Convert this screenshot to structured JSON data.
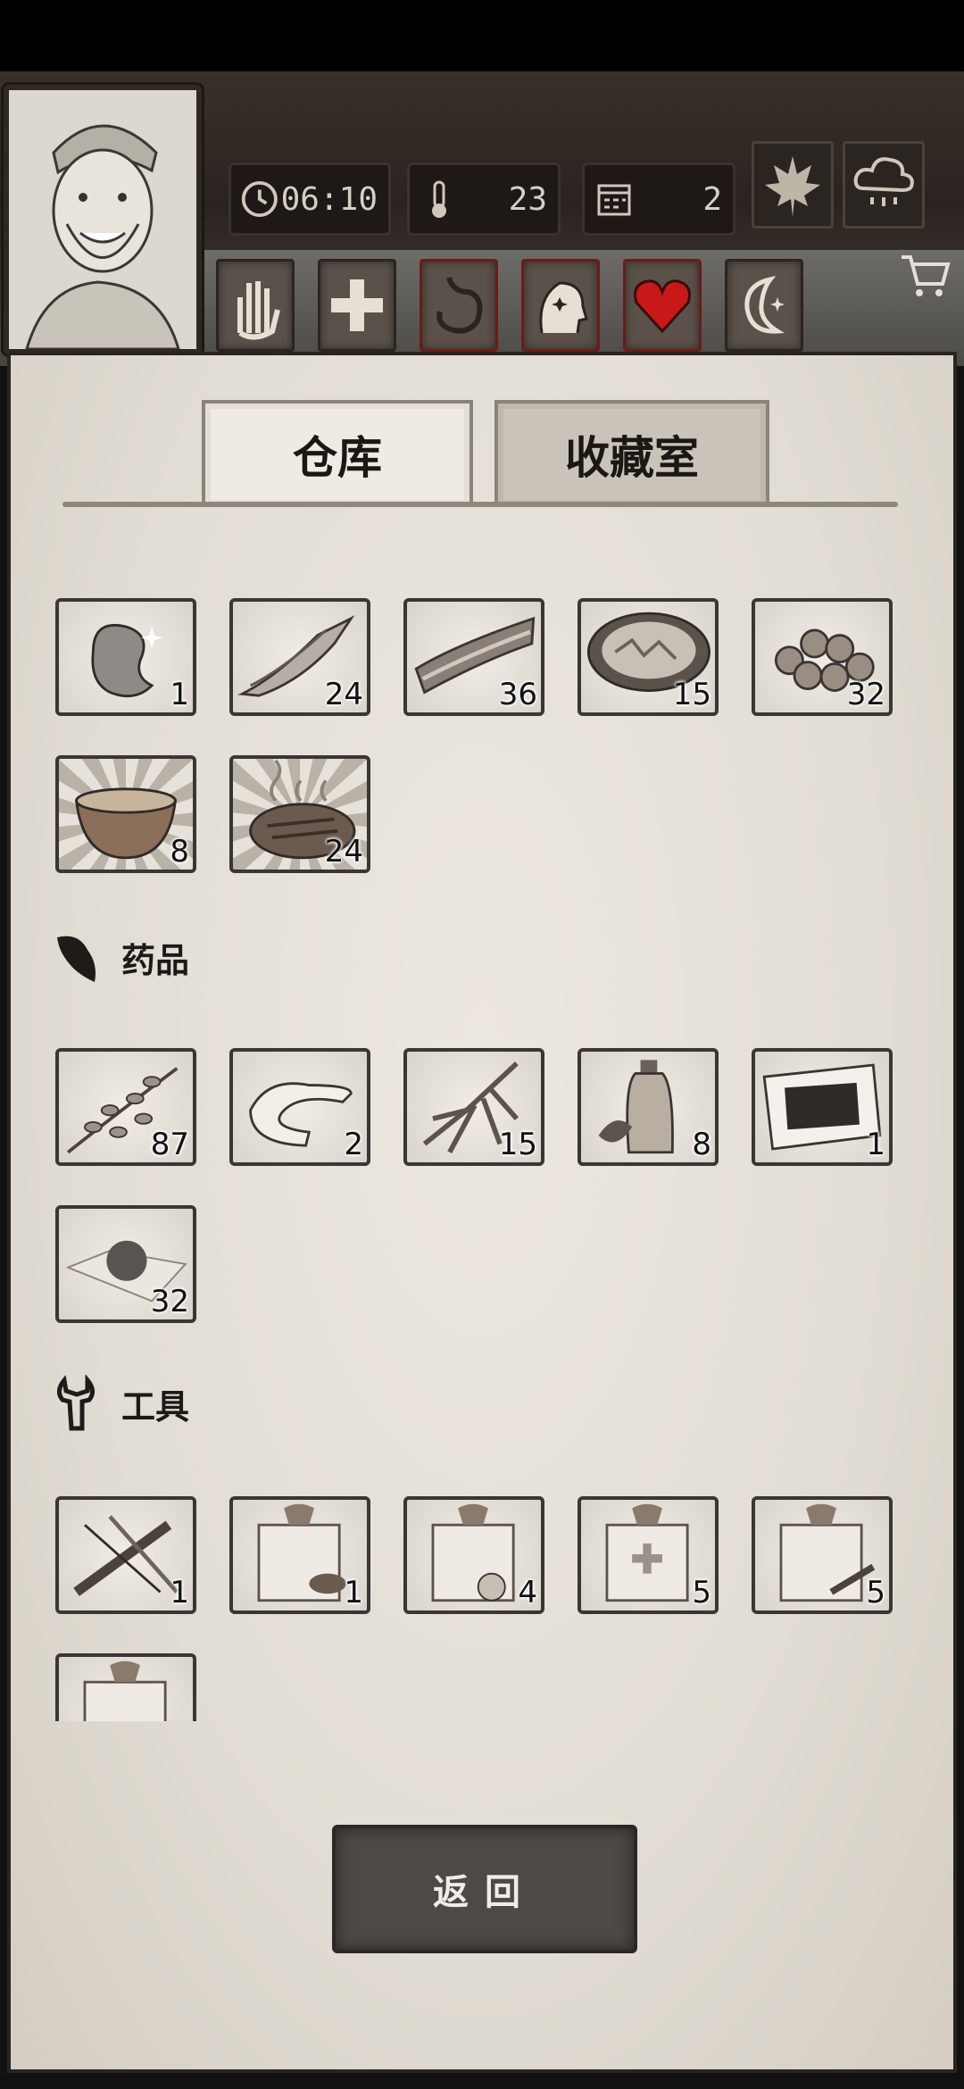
{
  "hud": {
    "time": "06:10",
    "temperature": "23",
    "day": "2",
    "season_icon": "maple-leaf-icon",
    "weather_icon": "rain-cloud-icon"
  },
  "status_icons": [
    "hand-icon",
    "health-cross-icon",
    "stomach-icon",
    "mind-icon",
    "heart-icon",
    "moon-icon"
  ],
  "tabs": {
    "warehouse": "仓库",
    "collection": "收藏室"
  },
  "sections": {
    "food": {
      "items": [
        {
          "name": "bean",
          "count": "1"
        },
        {
          "name": "dried-fish",
          "count": "24"
        },
        {
          "name": "bacon",
          "count": "36"
        },
        {
          "name": "salad-bowl",
          "count": "15"
        },
        {
          "name": "nuts",
          "count": "32"
        },
        {
          "name": "soup-bowl",
          "count": "8"
        },
        {
          "name": "steak",
          "count": "24"
        }
      ]
    },
    "medicine": {
      "title": "药品",
      "items": [
        {
          "name": "herb-branch",
          "count": "87"
        },
        {
          "name": "bandage",
          "count": "2"
        },
        {
          "name": "ginseng",
          "count": "15"
        },
        {
          "name": "herbal-oil",
          "count": "8"
        },
        {
          "name": "medicine-plaster",
          "count": "1"
        },
        {
          "name": "pill",
          "count": "32"
        }
      ]
    },
    "tools": {
      "title": "工具",
      "items": [
        {
          "name": "crossbow",
          "count": "1"
        },
        {
          "name": "wood-tool-box",
          "count": "1"
        },
        {
          "name": "food-box",
          "count": "4"
        },
        {
          "name": "medical-box",
          "count": "5"
        },
        {
          "name": "tool-box",
          "count": "5"
        },
        {
          "name": "gift-box",
          "count": ""
        }
      ]
    }
  },
  "back_button": "返回",
  "colors": {
    "paper": "#e6e1d8",
    "frame": "#2a2420",
    "heart": "#c81818"
  }
}
